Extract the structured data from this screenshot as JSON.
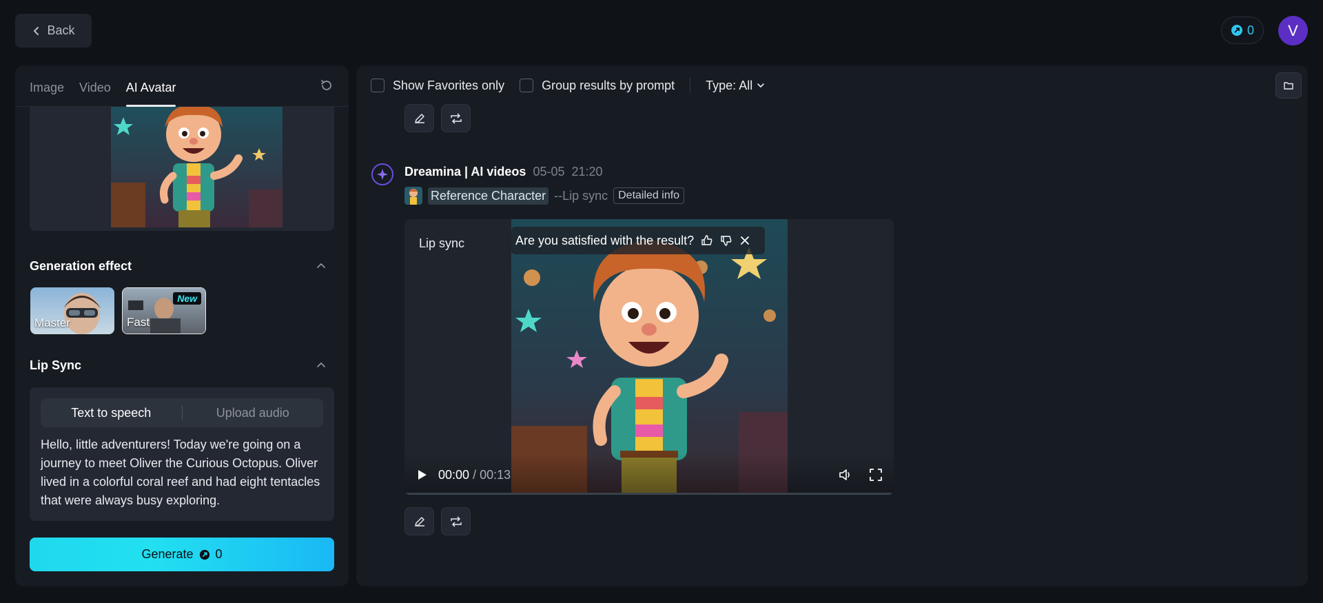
{
  "topbar": {
    "back_label": "Back",
    "credits": "0",
    "avatar_letter": "V"
  },
  "left_panel": {
    "tabs": [
      {
        "label": "Image",
        "active": false
      },
      {
        "label": "Video",
        "active": false
      },
      {
        "label": "AI Avatar",
        "active": true
      }
    ],
    "generation_effect": {
      "title": "Generation effect",
      "options": [
        {
          "label": "Master",
          "selected": false
        },
        {
          "label": "Fast",
          "selected": true,
          "badge": "New"
        }
      ]
    },
    "lip_sync": {
      "title": "Lip Sync",
      "segments": [
        {
          "label": "Text to speech",
          "active": true
        },
        {
          "label": "Upload audio",
          "active": false
        }
      ],
      "text": "Hello, little adventurers! Today we're going on a journey to meet Oliver the Curious Octopus. Oliver lived in a colorful coral reef and had eight tentacles that were always busy exploring."
    },
    "generate": {
      "label": "Generate",
      "cost": "0"
    }
  },
  "right_panel": {
    "filters": {
      "favorites_label": "Show Favorites only",
      "group_label": "Group results by prompt",
      "type_label": "Type: All"
    },
    "result": {
      "source": "Dreamina | AI videos",
      "date": "05-05",
      "time": "21:20",
      "reference_label": "Reference Character",
      "mode_tag": "--Lip sync",
      "detail_button": "Detailed info",
      "video_label": "Lip sync",
      "satisfaction_prompt": "Are you satisfied with the result?",
      "current_time": "00:00",
      "time_separator": "/",
      "total_time": "00:13",
      "progress": 0
    }
  },
  "colors": {
    "accent_cyan": "#22e0f0",
    "avatar_purple": "#5b2fc4",
    "brand_purple": "#6b4ce0"
  }
}
